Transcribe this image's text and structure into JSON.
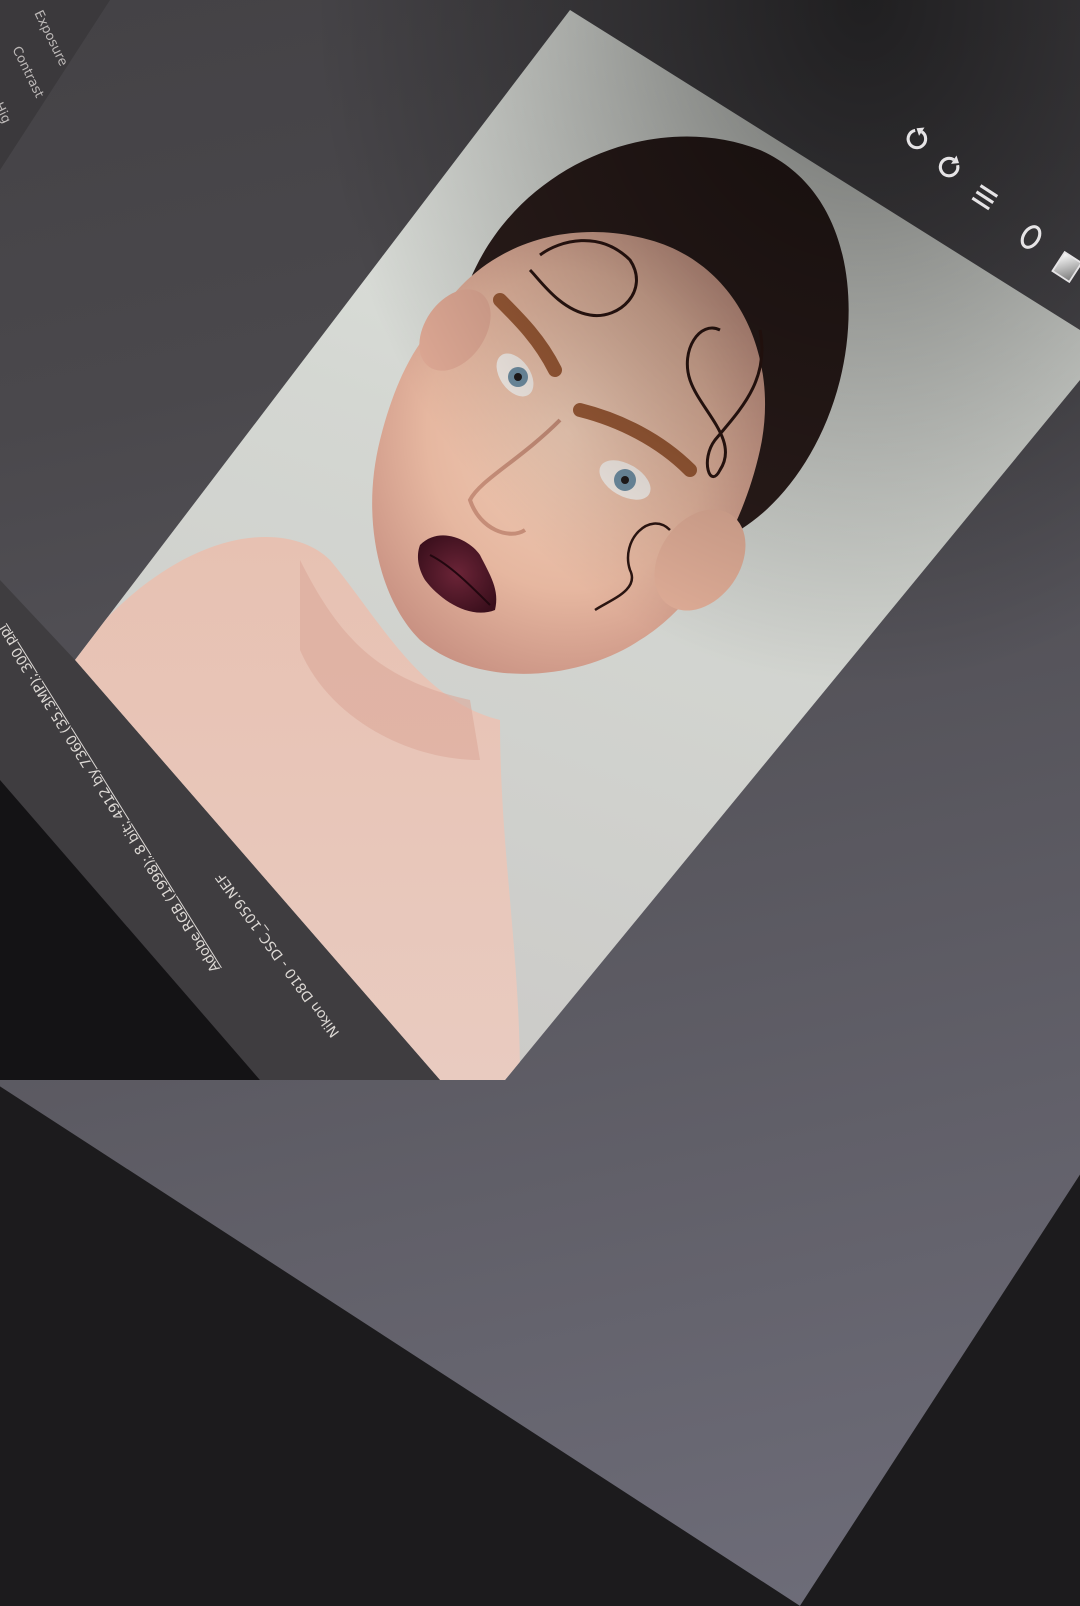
{
  "left_panel": {
    "items": [
      "Exposure",
      "Contrast",
      "Hig"
    ]
  },
  "toolbar": {
    "icons": [
      "rotate-left-icon",
      "rotate-right-icon",
      "list-icon",
      "circle-icon",
      "gradient-icon"
    ]
  },
  "status_bar": {
    "camera_file": "Nikon D810 - DSC_1059.NEF",
    "color_info": "Adobe RGB (1998); 8 bit; 4912 by 7360 (35.3MP); 300 ppi"
  },
  "colors": {
    "background": "#e3e6e1",
    "panel": "#3f3d40",
    "text": "#dcd8d4"
  }
}
